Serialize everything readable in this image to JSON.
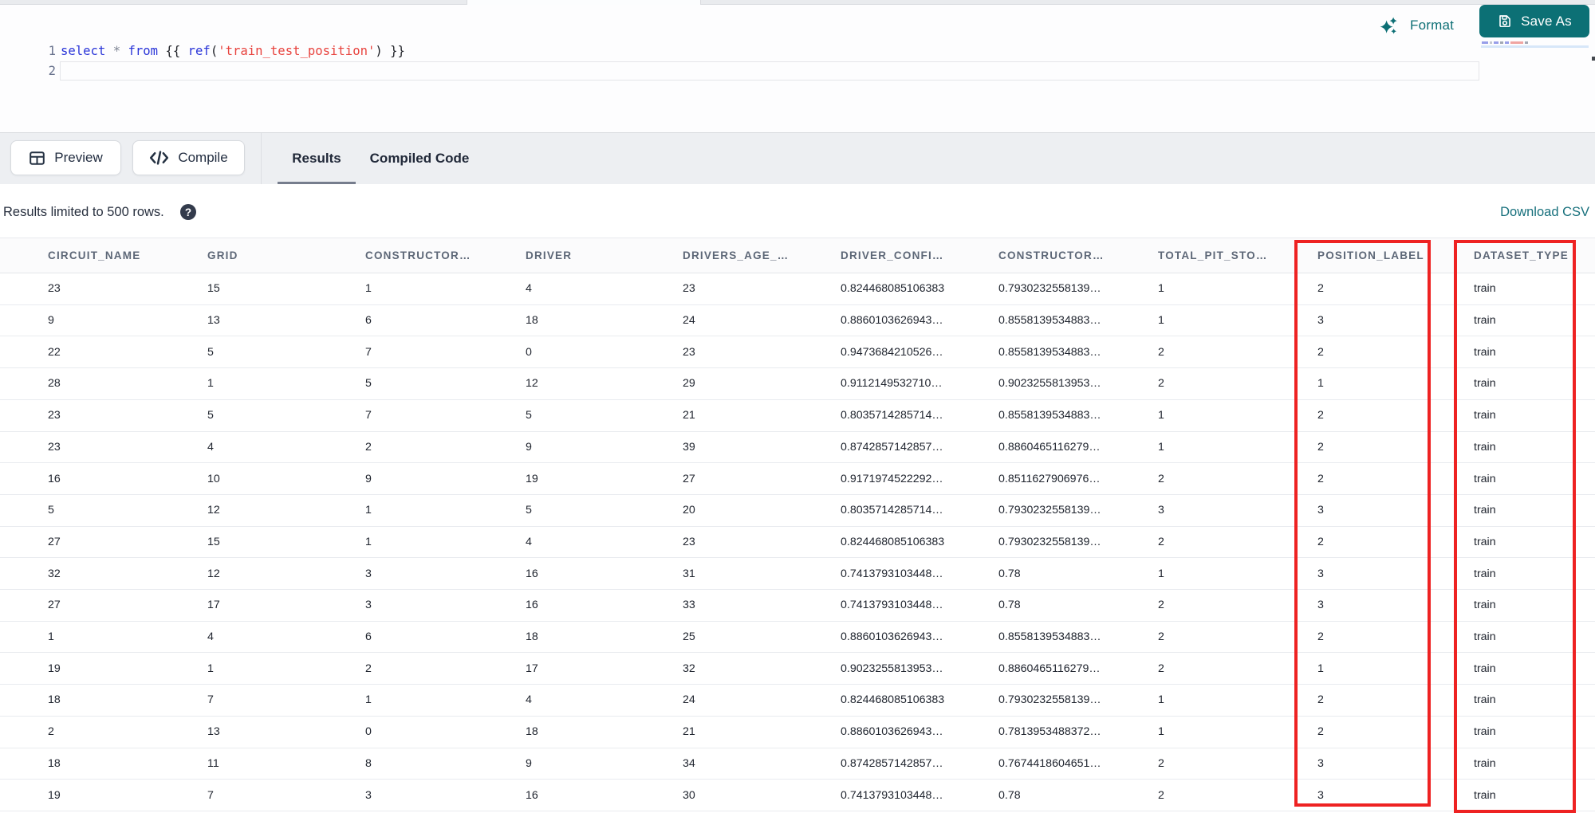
{
  "colors": {
    "teal": "#0c7075",
    "link_teal": "#17707c",
    "annotation_red": "#ee2222",
    "keyword_blue": "#2a35d8",
    "string_red": "#e8433e"
  },
  "editor": {
    "toolbar": {
      "format_label": "Format",
      "save_as_label": "Save As"
    },
    "gutter": [
      "1",
      "2"
    ],
    "code_line_tokens": [
      {
        "text": "select",
        "type": "keyword"
      },
      {
        "text": " ",
        "type": "plain"
      },
      {
        "text": "*",
        "type": "operator"
      },
      {
        "text": " ",
        "type": "plain"
      },
      {
        "text": "from",
        "type": "keyword"
      },
      {
        "text": " {{ ",
        "type": "plain"
      },
      {
        "text": "ref",
        "type": "keyword"
      },
      {
        "text": "(",
        "type": "plain"
      },
      {
        "text": "'train_test_position'",
        "type": "string"
      },
      {
        "text": ") }}",
        "type": "plain"
      }
    ]
  },
  "results_pane": {
    "preview_label": "Preview",
    "compile_label": "Compile",
    "tabs": [
      {
        "label": "Results",
        "active": true
      },
      {
        "label": "Compiled Code",
        "active": false
      }
    ],
    "info_text": "Results limited to 500 rows.",
    "help_icon_glyph": "?",
    "download_csv_label": "Download CSV"
  },
  "table": {
    "columns": [
      "CIRCUIT_NAME",
      "GRID",
      "CONSTRUCTOR…",
      "DRIVER",
      "DRIVERS_AGE_…",
      "DRIVER_CONFI…",
      "CONSTRUCTOR…",
      "TOTAL_PIT_STO…",
      "POSITION_LABEL",
      "DATASET_TYPE"
    ],
    "rows": [
      [
        "23",
        "15",
        "1",
        "4",
        "23",
        "0.824468085106383",
        "0.7930232558139…",
        "1",
        "2",
        "train"
      ],
      [
        "9",
        "13",
        "6",
        "18",
        "24",
        "0.8860103626943…",
        "0.8558139534883…",
        "1",
        "3",
        "train"
      ],
      [
        "22",
        "5",
        "7",
        "0",
        "23",
        "0.9473684210526…",
        "0.8558139534883…",
        "2",
        "2",
        "train"
      ],
      [
        "28",
        "1",
        "5",
        "12",
        "29",
        "0.9112149532710…",
        "0.9023255813953…",
        "2",
        "1",
        "train"
      ],
      [
        "23",
        "5",
        "7",
        "5",
        "21",
        "0.8035714285714…",
        "0.8558139534883…",
        "1",
        "2",
        "train"
      ],
      [
        "23",
        "4",
        "2",
        "9",
        "39",
        "0.8742857142857…",
        "0.8860465116279…",
        "1",
        "2",
        "train"
      ],
      [
        "16",
        "10",
        "9",
        "19",
        "27",
        "0.9171974522292…",
        "0.8511627906976…",
        "2",
        "2",
        "train"
      ],
      [
        "5",
        "12",
        "1",
        "5",
        "20",
        "0.8035714285714…",
        "0.7930232558139…",
        "3",
        "3",
        "train"
      ],
      [
        "27",
        "15",
        "1",
        "4",
        "23",
        "0.824468085106383",
        "0.7930232558139…",
        "2",
        "2",
        "train"
      ],
      [
        "32",
        "12",
        "3",
        "16",
        "31",
        "0.7413793103448…",
        "0.78",
        "1",
        "3",
        "train"
      ],
      [
        "27",
        "17",
        "3",
        "16",
        "33",
        "0.7413793103448…",
        "0.78",
        "2",
        "3",
        "train"
      ],
      [
        "1",
        "4",
        "6",
        "18",
        "25",
        "0.8860103626943…",
        "0.8558139534883…",
        "2",
        "2",
        "train"
      ],
      [
        "19",
        "1",
        "2",
        "17",
        "32",
        "0.9023255813953…",
        "0.8860465116279…",
        "2",
        "1",
        "train"
      ],
      [
        "18",
        "7",
        "1",
        "4",
        "24",
        "0.824468085106383",
        "0.7930232558139…",
        "1",
        "2",
        "train"
      ],
      [
        "2",
        "13",
        "0",
        "18",
        "21",
        "0.8860103626943…",
        "0.7813953488372…",
        "1",
        "2",
        "train"
      ],
      [
        "18",
        "11",
        "8",
        "9",
        "34",
        "0.8742857142857…",
        "0.7674418604651…",
        "2",
        "3",
        "train"
      ],
      [
        "19",
        "7",
        "3",
        "16",
        "30",
        "0.7413793103448…",
        "0.78",
        "2",
        "3",
        "train"
      ]
    ],
    "annotations": {
      "highlighted_columns": [
        "POSITION_LABEL",
        "DATASET_TYPE"
      ]
    }
  }
}
